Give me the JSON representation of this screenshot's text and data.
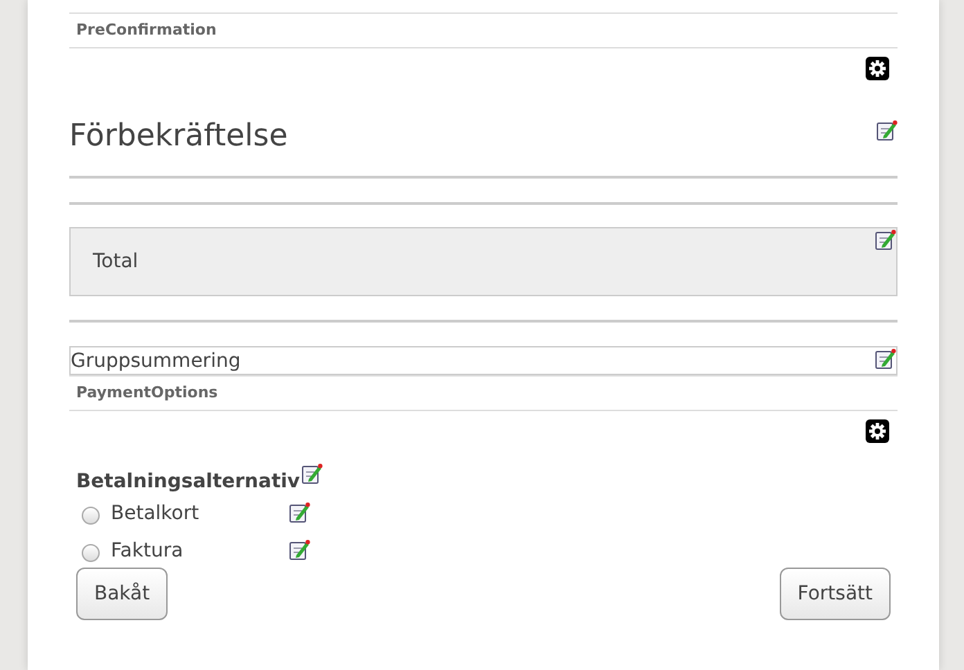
{
  "sections": [
    {
      "kind": "label",
      "text": "PreConfirmation"
    },
    {
      "kind": "gear"
    },
    {
      "kind": "heading",
      "text": "Förbekräftelse"
    },
    {
      "kind": "rule"
    },
    {
      "kind": "panel",
      "text": "Total"
    },
    {
      "kind": "rule"
    },
    {
      "kind": "outlined",
      "text": "Gruppsummering"
    },
    {
      "kind": "label",
      "text": "PaymentOptions"
    },
    {
      "kind": "gear"
    }
  ],
  "payment": {
    "title": "Betalningsalternativ",
    "options": [
      {
        "label": "Betalkort",
        "selected": false
      },
      {
        "label": "Faktura",
        "selected": false
      }
    ]
  },
  "buttons": {
    "back": "Bakåt",
    "next": "Fortsätt"
  }
}
